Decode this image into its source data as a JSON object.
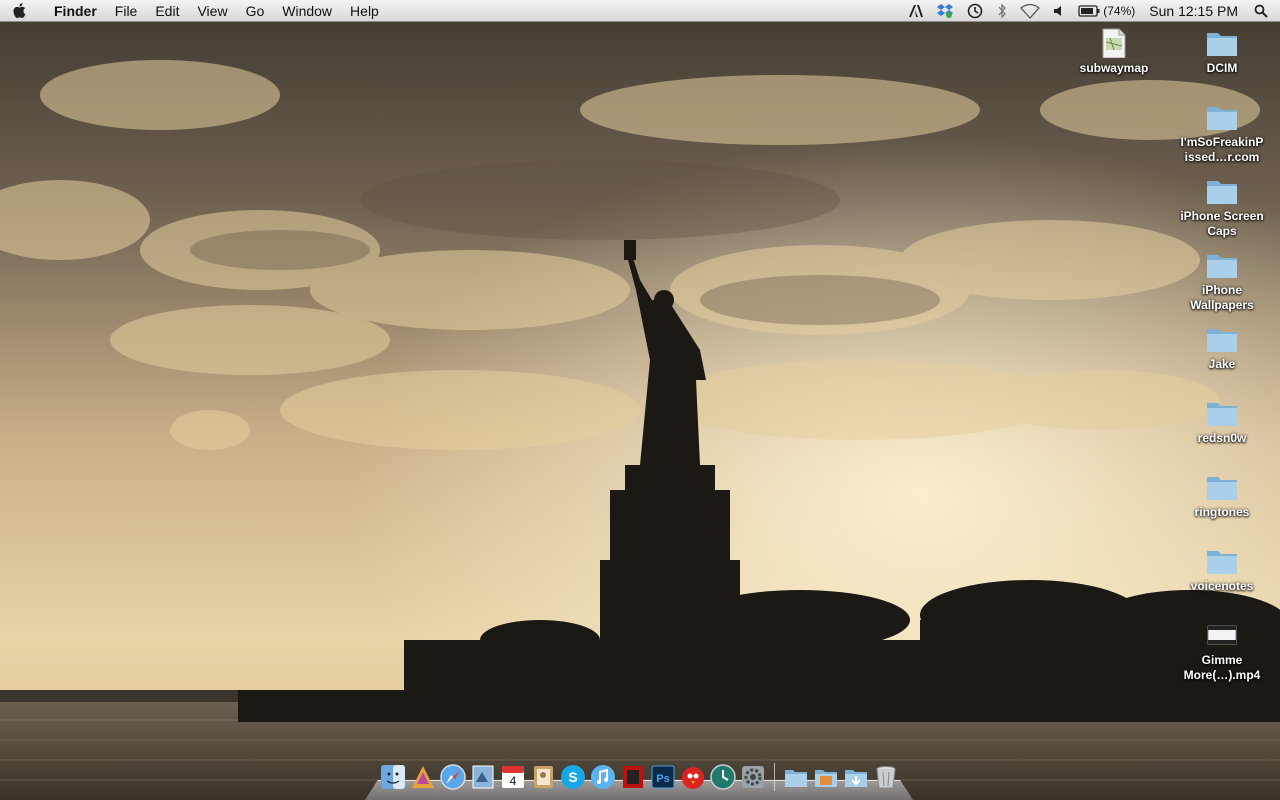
{
  "menubar": {
    "app_name": "Finder",
    "menus": [
      "File",
      "Edit",
      "View",
      "Go",
      "Window",
      "Help"
    ],
    "status_icons": [
      "adobe-icon",
      "dropbox-icon",
      "time-machine-icon",
      "bluetooth-icon",
      "wifi-icon",
      "volume-icon",
      "battery-icon",
      "spotlight-icon"
    ],
    "battery_percent": "(74%)",
    "clock": "Sun 12:15 PM"
  },
  "desktop": {
    "icons": [
      {
        "label": "subwaymap",
        "type": "pdf"
      },
      {
        "label": "DCIM",
        "type": "folder"
      },
      {
        "label": "I'mSoFreakinP issed…r.com",
        "type": "folder"
      },
      {
        "label": "iPhone Screen Caps",
        "type": "folder"
      },
      {
        "label": "iPhone Wallpapers",
        "type": "folder"
      },
      {
        "label": "Jake",
        "type": "folder"
      },
      {
        "label": "redsn0w",
        "type": "folder"
      },
      {
        "label": "ringtones",
        "type": "folder"
      },
      {
        "label": "voicenotes",
        "type": "folder"
      },
      {
        "label": "Gimme More(…).mp4",
        "type": "video"
      }
    ]
  },
  "dock": {
    "apps": [
      "Finder",
      "TextMate",
      "Safari",
      "Preview",
      "iCal",
      "Address Book",
      "Skype",
      "iTunes",
      "Photo Booth",
      "Photoshop",
      "Angry Birds",
      "Time Machine",
      "System Preferences"
    ],
    "calendar_day": "4",
    "stacks": [
      "Applications",
      "Documents",
      "Downloads"
    ],
    "trash": "Trash"
  },
  "colors": {
    "folder": "#a9cfe9",
    "folder_dark": "#7fb0d6",
    "sky": "#c9a878"
  }
}
